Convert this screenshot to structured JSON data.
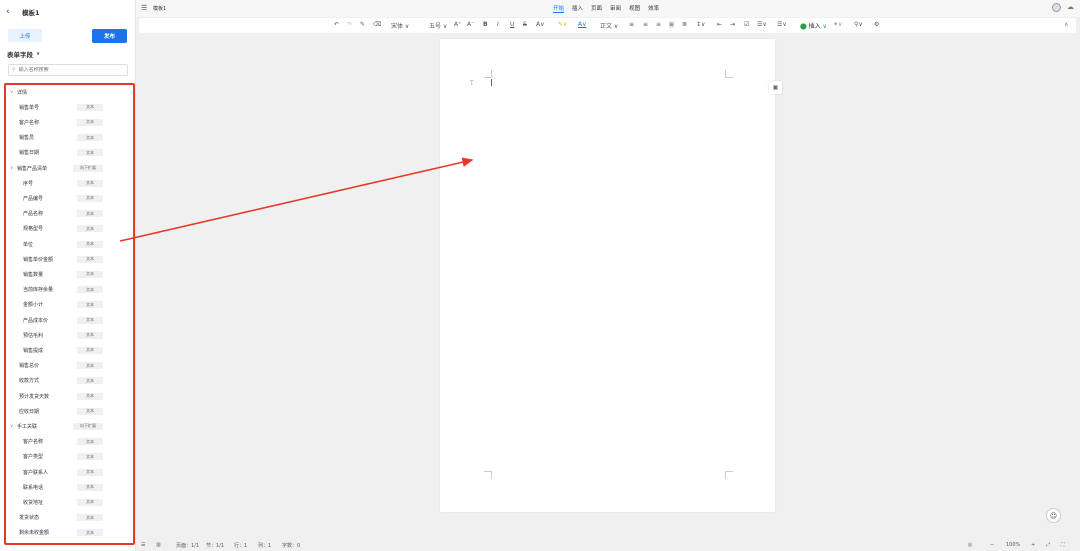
{
  "left_panel": {
    "back_icon": "chevron-left-icon",
    "title": "模板1",
    "upload_label": "上传",
    "publish_label": "发布",
    "section_title": "表单字段",
    "search_placeholder": "输入名称搜索",
    "fields": [
      {
        "label": "详情",
        "tag": "",
        "caret": true
      },
      {
        "label": "销售单号",
        "tag": "文本"
      },
      {
        "label": "客户名称",
        "tag": "文本"
      },
      {
        "label": "销售员",
        "tag": "文本"
      },
      {
        "label": "销售日期",
        "tag": "文本"
      },
      {
        "label": "销售产品清单",
        "tag": "向下扩展",
        "caret": true
      },
      {
        "label": "序号",
        "tag": "文本"
      },
      {
        "label": "产品编号",
        "tag": "文本"
      },
      {
        "label": "产品名称",
        "tag": "文本"
      },
      {
        "label": "规格型号",
        "tag": "文本"
      },
      {
        "label": "单位",
        "tag": "文本"
      },
      {
        "label": "销售单价金额",
        "tag": "文本"
      },
      {
        "label": "销售数量",
        "tag": "文本"
      },
      {
        "label": "当前库存余量",
        "tag": "文本"
      },
      {
        "label": "金额小计",
        "tag": "文本"
      },
      {
        "label": "产品成本价",
        "tag": "文本"
      },
      {
        "label": "预估毛利",
        "tag": "文本"
      },
      {
        "label": "销售提成",
        "tag": "文本"
      },
      {
        "label": "销售总价",
        "tag": "文本"
      },
      {
        "label": "收款方式",
        "tag": "文本"
      },
      {
        "label": "预计发货天数",
        "tag": "文本"
      },
      {
        "label": "应收日期",
        "tag": "文本"
      },
      {
        "label": "手工关联",
        "tag": "向下扩展",
        "caret": true
      },
      {
        "label": "客户名称",
        "tag": "文本"
      },
      {
        "label": "客户类型",
        "tag": "文本"
      },
      {
        "label": "客户联系人",
        "tag": "文本"
      },
      {
        "label": "联系电话",
        "tag": "文本"
      },
      {
        "label": "收货地址",
        "tag": "文本"
      },
      {
        "label": "发货状态",
        "tag": "文本"
      },
      {
        "label": "剩余未收金额",
        "tag": "文本"
      }
    ]
  },
  "topbar": {
    "doc_name": "模板1",
    "tabs": [
      "开始",
      "插入",
      "页面",
      "审阅",
      "视图",
      "效率"
    ],
    "active_tab": "开始"
  },
  "toolbar": {
    "font_family": "宋体",
    "font_size": "五号",
    "style": "正文",
    "insert_label": "插入"
  },
  "statusbar": {
    "page": "页面：1/1",
    "section": "节：1/1",
    "row": "行：1",
    "col": "列：1",
    "words": "字数：0",
    "zoom": "100%"
  },
  "colors": {
    "accent": "#1a73e8",
    "highlight_border": "#e53a2a"
  }
}
